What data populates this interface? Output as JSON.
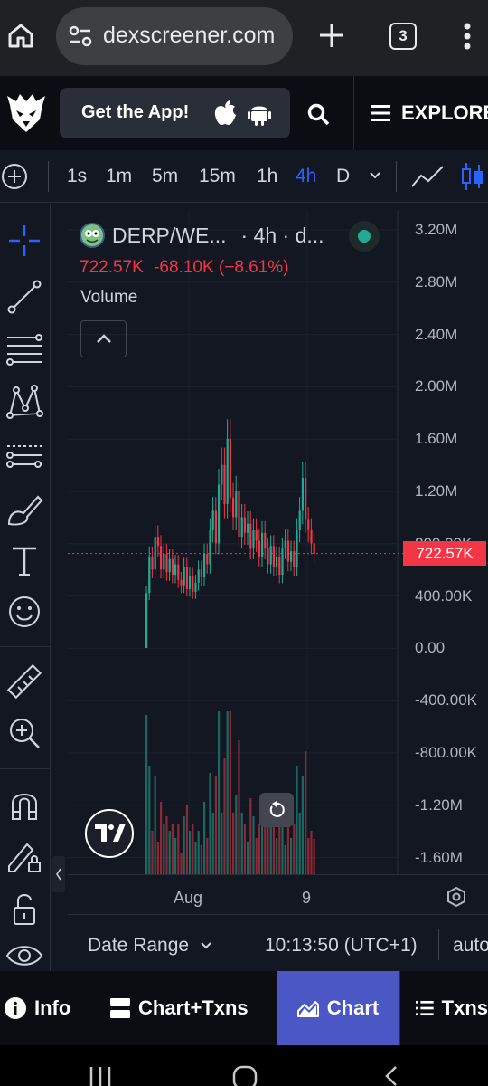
{
  "browser": {
    "url": "dexscreener.com",
    "tab_count": "3"
  },
  "header": {
    "get_app_label": "Get the App!",
    "explore_label": "EXPLORE"
  },
  "timeframes": {
    "items": [
      "1s",
      "1m",
      "5m",
      "15m",
      "1h",
      "4h",
      "D"
    ],
    "active": "4h"
  },
  "legend": {
    "pair": "DERP/WE...",
    "meta": "· 4h · d...",
    "last": "722.57K",
    "change": "-68.10K (−8.61%)",
    "volume_label": "Volume"
  },
  "price_axis": {
    "labels": [
      "3.20M",
      "2.80M",
      "2.40M",
      "2.00M",
      "1.60M",
      "1.20M",
      "800.00K",
      "400.00K",
      "0.00",
      "-400.00K",
      "-800.00K",
      "-1.20M",
      "-1.60M"
    ],
    "last_price_tag": "722.57K"
  },
  "time_axis": {
    "labels": [
      "Aug",
      "9"
    ]
  },
  "chart_controls": {
    "date_range": "Date Range",
    "clock": "10:13:50 (UTC+1)",
    "scale": "auto"
  },
  "bottom_tabs": {
    "info": "Info",
    "chart_txns": "Chart+Txns",
    "chart": "Chart",
    "txns": "Txns",
    "active": "Chart"
  },
  "colors": {
    "up": "#22ab94",
    "down": "#f23645",
    "accent": "#2962ff",
    "active_tab": "#4a57c4"
  },
  "chart_data": {
    "type": "candlestick",
    "title": "DERP/WE...",
    "interval": "4h",
    "ylim": [
      -1800000,
      3300000
    ],
    "x_labels": [
      "Aug",
      "9"
    ],
    "last_price": 722570,
    "candles": [
      [
        0,
        420000
      ],
      [
        420000,
        700000
      ],
      [
        700000,
        600000
      ],
      [
        600000,
        850000
      ],
      [
        850000,
        780000
      ],
      [
        780000,
        600000
      ],
      [
        600000,
        720000
      ],
      [
        720000,
        580000
      ],
      [
        580000,
        680000
      ],
      [
        680000,
        560000
      ],
      [
        560000,
        640000
      ],
      [
        640000,
        520000
      ],
      [
        520000,
        480000
      ],
      [
        480000,
        620000
      ],
      [
        620000,
        450000
      ],
      [
        450000,
        550000
      ],
      [
        550000,
        430000
      ],
      [
        430000,
        500000
      ],
      [
        500000,
        600000
      ],
      [
        600000,
        540000
      ],
      [
        540000,
        720000
      ],
      [
        720000,
        640000
      ],
      [
        640000,
        900000
      ],
      [
        900000,
        1050000
      ],
      [
        1050000,
        800000
      ],
      [
        800000,
        1250000
      ],
      [
        1250000,
        1400000
      ],
      [
        1400000,
        1100000
      ],
      [
        1100000,
        1600000
      ],
      [
        1600000,
        1150000
      ],
      [
        1150000,
        1000000
      ],
      [
        1000000,
        1200000
      ],
      [
        1200000,
        850000
      ],
      [
        850000,
        1000000
      ],
      [
        1000000,
        880000
      ],
      [
        880000,
        950000
      ],
      [
        950000,
        760000
      ],
      [
        760000,
        900000
      ],
      [
        900000,
        820000
      ],
      [
        820000,
        700000
      ],
      [
        700000,
        880000
      ],
      [
        880000,
        760000
      ],
      [
        760000,
        640000
      ],
      [
        640000,
        780000
      ],
      [
        780000,
        620000
      ],
      [
        620000,
        700000
      ],
      [
        700000,
        560000
      ],
      [
        560000,
        760000
      ],
      [
        760000,
        820000
      ],
      [
        820000,
        660000
      ],
      [
        660000,
        740000
      ],
      [
        740000,
        620000
      ],
      [
        620000,
        900000
      ],
      [
        900000,
        1050000
      ],
      [
        1050000,
        1300000
      ],
      [
        1300000,
        980000
      ],
      [
        980000,
        900000
      ],
      [
        900000,
        800000
      ],
      [
        800000,
        722570
      ]
    ],
    "volume_note": "histogram below price"
  }
}
